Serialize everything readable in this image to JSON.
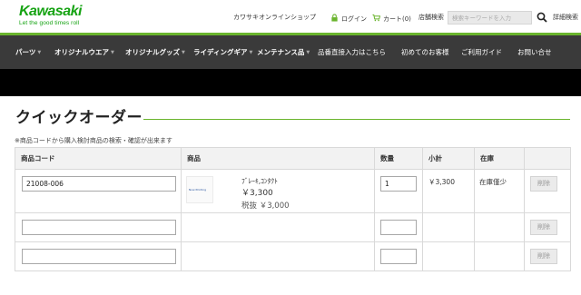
{
  "brand": {
    "name": "Kawasaki",
    "tagline": "Let the good times roll",
    "color": "#16a313"
  },
  "header": {
    "shop_link": "カワサキオンラインショップ",
    "login_label": "ログイン",
    "cart_label": "カート(0)",
    "store_search_label": "店舗検索",
    "search_placeholder": "検索キーワードを入力",
    "advanced_search_label": "詳細検索"
  },
  "nav": {
    "items": [
      {
        "label": "パーツ",
        "has_caret": true
      },
      {
        "label": "オリジナルウエア",
        "has_caret": true
      },
      {
        "label": "オリジナルグッズ",
        "has_caret": true
      },
      {
        "label": "ライディングギア",
        "has_caret": true
      },
      {
        "label": "メンテナンス品",
        "has_caret": true
      },
      {
        "label": "品番直接入力はこちら",
        "has_caret": false
      },
      {
        "label": "初めてのお客様",
        "has_caret": false
      },
      {
        "label": "ご利用ガイド",
        "has_caret": false
      },
      {
        "label": "お問い合せ",
        "has_caret": false
      }
    ]
  },
  "page": {
    "title": "クイックオーダー",
    "note": "※商品コードから購入検討商品の検索・確認が出来ます"
  },
  "table": {
    "headers": {
      "code": "商品コード",
      "product": "商品",
      "quantity": "数量",
      "subtotal": "小計",
      "stock": "在庫"
    },
    "rows": [
      {
        "code": "21008-006",
        "thumb_text": "Now Printing",
        "product_name": "ﾌﾞﾚｰｷ,ｺﾝﾀｸﾄ",
        "price": "￥3,300",
        "tax_excluded": "税抜 ￥3,000",
        "quantity": "1",
        "subtotal": "￥3,300",
        "stock": "在庫僅少",
        "delete_label": "削除"
      },
      {
        "code": "",
        "quantity": "",
        "delete_label": "削除"
      },
      {
        "code": "",
        "quantity": "",
        "delete_label": "削除"
      }
    ]
  },
  "colors": {
    "accent_green": "#6ab42d",
    "nav_bg": "#3a3a3a",
    "band_bg": "#000000"
  }
}
